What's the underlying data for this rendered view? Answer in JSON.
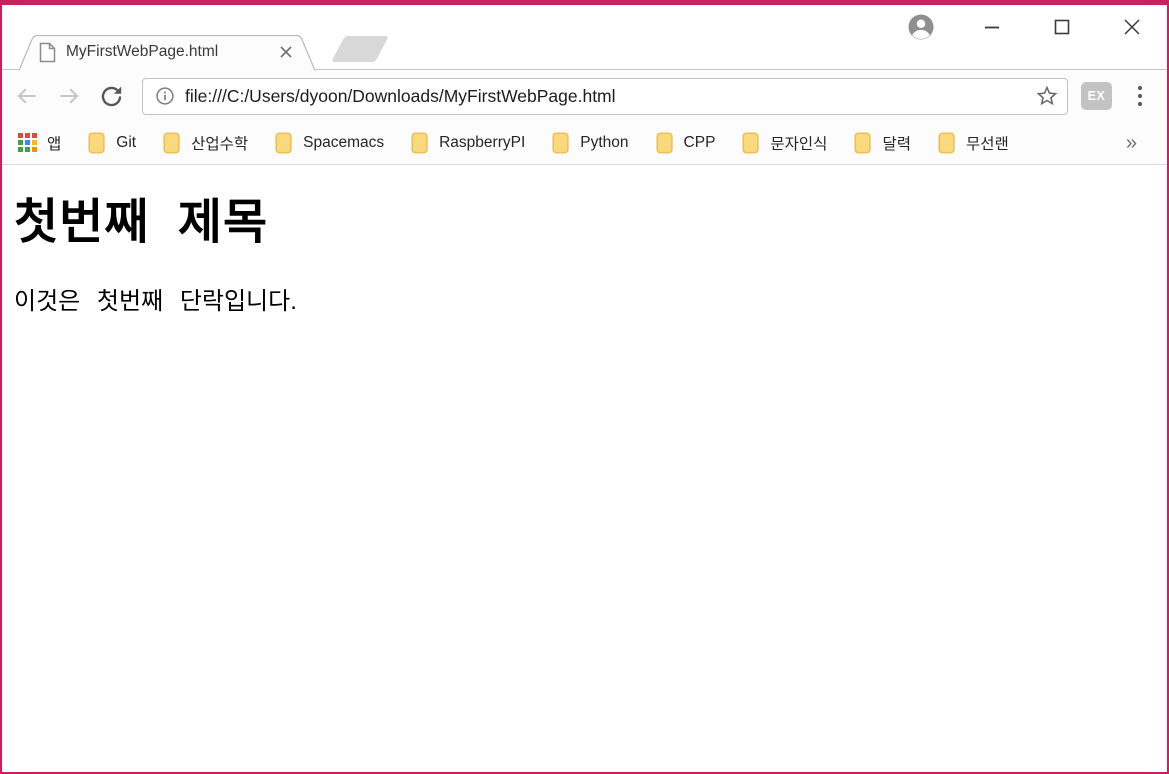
{
  "window": {
    "frame_color": "#C9215F",
    "tab_title": "MyFirstWebPage.html",
    "controls": {
      "profile_icon": "profile-avatar",
      "minimize_icon": "minimize",
      "maximize_icon": "maximize",
      "close_icon": "close"
    }
  },
  "toolbar": {
    "back_icon": "back-arrow",
    "forward_icon": "forward-arrow",
    "reload_icon": "reload",
    "page_info_icon": "page-info",
    "url": "file:///C:/Users/dyoon/Downloads/MyFirstWebPage.html",
    "bookmark_star_icon": "bookmark-star",
    "extension_badge_label": "EX",
    "menu_icon": "three-dot-menu"
  },
  "bookmarks_bar": {
    "apps_label": "앱",
    "folders": [
      "Git",
      "산업수학",
      "Spacemacs",
      "RaspberryPI",
      "Python",
      "CPP",
      "문자인식",
      "달력",
      "무선랜"
    ],
    "overflow_label": "»"
  },
  "page": {
    "heading": "첫번째 제목",
    "paragraph": "이것은 첫번째 단락입니다."
  }
}
